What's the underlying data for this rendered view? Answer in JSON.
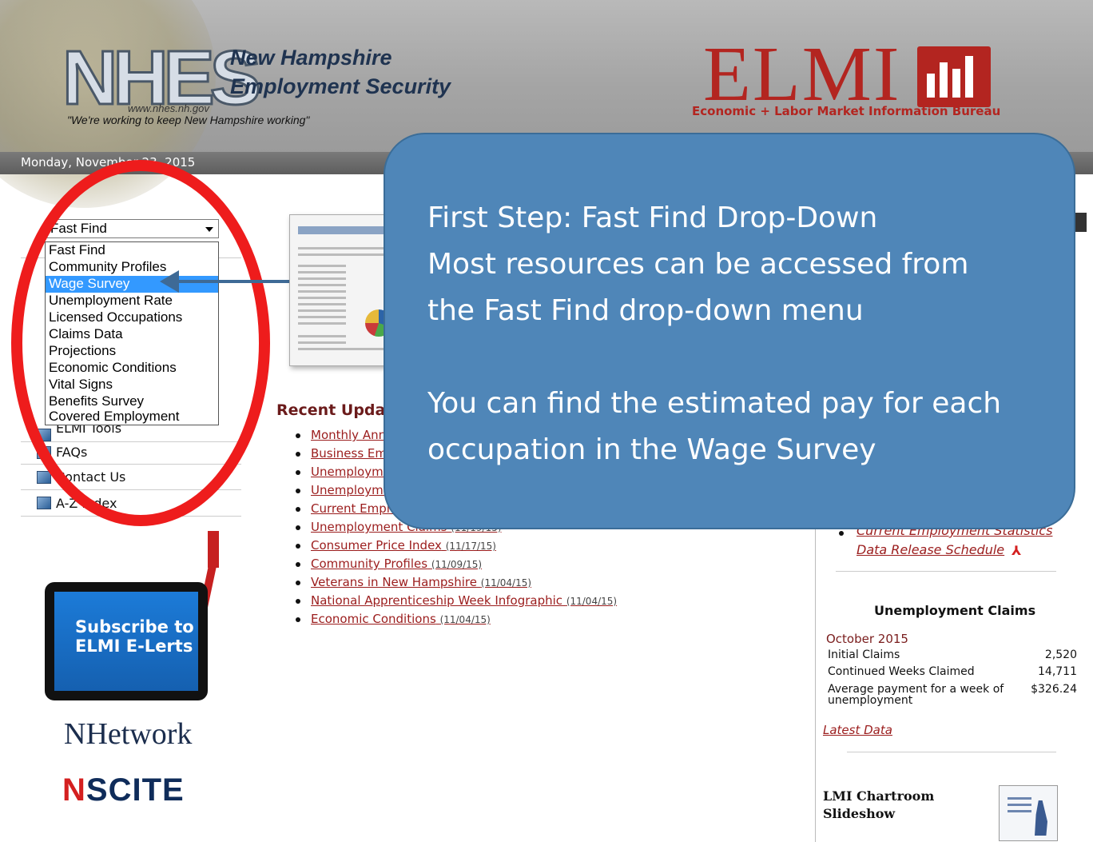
{
  "header": {
    "org_line1": "New Hampshire",
    "org_line2": "Employment Security",
    "logo_text": "NHES",
    "website": "www.nhes.nh.gov",
    "tagline": "\"We're working to keep New Hampshire working\"",
    "elmi_logo": "ELMI",
    "elmi_subtitle": "Economic + Labor Market Information Bureau",
    "date": "Monday, November 23, 2015"
  },
  "fast_find": {
    "selected": "Fast Find",
    "options": [
      "Fast Find",
      "Community Profiles",
      "Wage Survey",
      "Unemployment Rate",
      "Licensed Occupations",
      "Claims Data",
      "Projections",
      "Economic Conditions",
      "Vital Signs",
      "Benefits Survey",
      "Covered Employment"
    ],
    "highlighted": "Wage Survey"
  },
  "left_nav": {
    "partial_item": "ELMI Tools",
    "items": [
      "FAQs",
      "Contact Us",
      "A-Z Index"
    ]
  },
  "promo": {
    "subscribe_line1": "Subscribe to",
    "subscribe_line2": "ELMI E-Lerts",
    "nhetwork": "NHetwork",
    "nscite_n": "N",
    "nscite_rest": "SCITE"
  },
  "recent_updates": {
    "title": "Recent Updates",
    "items": [
      {
        "label": "Monthly Annual",
        "date": ""
      },
      {
        "label": "Business Employment",
        "date": ""
      },
      {
        "label": "Unemployment",
        "date": ""
      },
      {
        "label": "Unemployment",
        "date": ""
      },
      {
        "label": "Current Employment",
        "date": ""
      },
      {
        "label": "Unemployment Claims",
        "date": "(11/19/15)"
      },
      {
        "label": "Consumer Price Index",
        "date": "(11/17/15)"
      },
      {
        "label": "Community Profiles",
        "date": "(11/09/15)"
      },
      {
        "label": "Veterans in New Hampshire",
        "date": "(11/04/15)"
      },
      {
        "label": "National Apprenticeship Week Infographic",
        "date": "(11/04/15)"
      },
      {
        "label": "Economic Conditions",
        "date": "(11/04/15)"
      }
    ]
  },
  "right_col": {
    "ces_link": "Current Employment Statistics",
    "schedule_link": "Data Release Schedule",
    "unemployment_claims": {
      "title": "Unemployment Claims",
      "month": "October 2015",
      "rows": [
        {
          "label": "Initial Claims",
          "value": "2,520"
        },
        {
          "label": "Continued Weeks Claimed",
          "value": "14,711"
        },
        {
          "label": "Average payment for a week of unemployment",
          "value": "$326.24"
        }
      ],
      "latest": "Latest Data"
    },
    "chartroom_line1": "LMI Chartroom",
    "chartroom_line2": "Slideshow"
  },
  "callout": {
    "line1": "First Step: Fast Find Drop-Down",
    "line2": "Most resources can be accessed from",
    "line3": "the Fast Find drop-down menu",
    "line4": "You can find the estimated pay for each",
    "line5": "occupation in the Wage Survey"
  },
  "colors": {
    "callout_bg": "#4f86b8",
    "oval": "#ee1c1c",
    "link": "#9b1d1d",
    "selection": "#3399ff"
  }
}
